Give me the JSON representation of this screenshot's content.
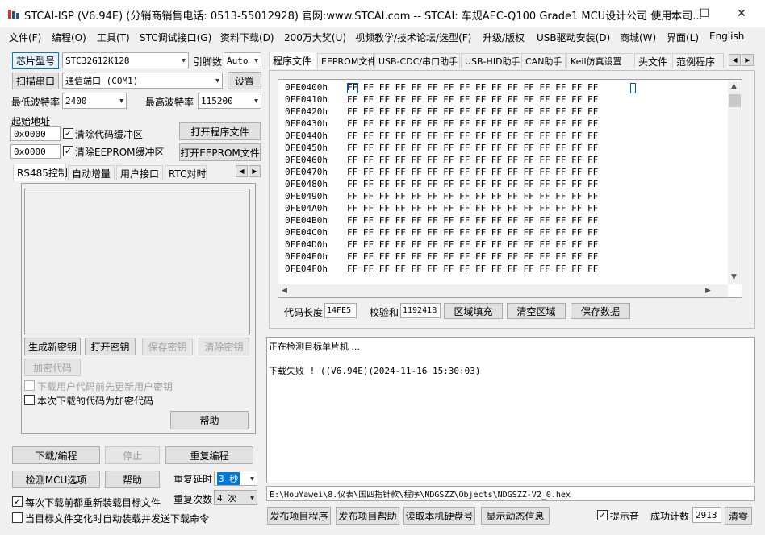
{
  "title": "STCAI-ISP (V6.94E) (分销商销售电话: 0513-55012928) 官网:www.STCAI.com  -- STCAI: 车规AEC-Q100 Grade1 MCU设计公司 使用本司...",
  "window_controls": {
    "minimize": "—",
    "maximize": "☐",
    "close": "✕"
  },
  "menu": [
    "文件(F)",
    "编程(O)",
    "工具(T)",
    "STC调试接口(G)",
    "资料下载(D)",
    "200万大奖(U)",
    "视频教学/技术论坛/选型(F)",
    "升级/版权",
    "USB驱动安装(D)",
    "商城(W)",
    "界面(L)",
    "English"
  ],
  "left": {
    "chip_button": "芯片型号",
    "chip_value": "STC32G12K128",
    "pin_label": "引脚数",
    "pin_value": "Auto",
    "scan_button": "扫描串口",
    "port_value": "通信端口 (COM1)",
    "settings_button": "设置",
    "min_baud_label": "最低波特率",
    "min_baud_value": "2400",
    "max_baud_label": "最高波特率",
    "max_baud_value": "115200",
    "start_addr_label": "起始地址",
    "addr1": "0x0000",
    "clear_code_label": "清除代码缓冲区",
    "open_prog_button": "打开程序文件",
    "addr2": "0x0000",
    "clear_eeprom_label": "清除EEPROM缓冲区",
    "open_eeprom_button": "打开EEPROM文件",
    "tabs": [
      "RS485控制",
      "自动增量",
      "用户接口",
      "RTC对时"
    ],
    "gen_key": "生成新密钥",
    "open_key": "打开密钥",
    "save_key": "保存密钥",
    "clear_key": "清除密钥",
    "encrypt_code": "加密代码",
    "chk_update_key": "下载用户代码前先更新用户密钥",
    "chk_encrypt": "本次下载的代码为加密代码",
    "help": "帮助",
    "download": "下载/编程",
    "stop": "停止",
    "reprogram": "重复编程",
    "check_mcu": "检测MCU选项",
    "help2": "帮助",
    "repeat_delay_label": "重复延时",
    "repeat_delay_value": "3 秒",
    "repeat_count_label": "重复次数",
    "repeat_count_value": "4 次",
    "chk_reload": "每次下载前都重新装载目标文件",
    "chk_auto": "当目标文件变化时自动装载并发送下载命令"
  },
  "right": {
    "tabs": [
      "程序文件",
      "EEPROM文件",
      "USB-CDC/串口助手",
      "USB-HID助手",
      "CAN助手",
      "Keil仿真设置",
      "头文件",
      "范例程序"
    ],
    "hex_rows": [
      {
        "addr": "0FE0400h",
        "bytes": "FF FF FF FF FF FF FF FF FF FF FF FF FF FF FF FF"
      },
      {
        "addr": "0FE0410h",
        "bytes": "FF FF FF FF FF FF FF FF FF FF FF FF FF FF FF FF"
      },
      {
        "addr": "0FE0420h",
        "bytes": "FF FF FF FF FF FF FF FF FF FF FF FF FF FF FF FF"
      },
      {
        "addr": "0FE0430h",
        "bytes": "FF FF FF FF FF FF FF FF FF FF FF FF FF FF FF FF"
      },
      {
        "addr": "0FE0440h",
        "bytes": "FF FF FF FF FF FF FF FF FF FF FF FF FF FF FF FF"
      },
      {
        "addr": "0FE0450h",
        "bytes": "FF FF FF FF FF FF FF FF FF FF FF FF FF FF FF FF"
      },
      {
        "addr": "0FE0460h",
        "bytes": "FF FF FF FF FF FF FF FF FF FF FF FF FF FF FF FF"
      },
      {
        "addr": "0FE0470h",
        "bytes": "FF FF FF FF FF FF FF FF FF FF FF FF FF FF FF FF"
      },
      {
        "addr": "0FE0480h",
        "bytes": "FF FF FF FF FF FF FF FF FF FF FF FF FF FF FF FF"
      },
      {
        "addr": "0FE0490h",
        "bytes": "FF FF FF FF FF FF FF FF FF FF FF FF FF FF FF FF"
      },
      {
        "addr": "0FE04A0h",
        "bytes": "FF FF FF FF FF FF FF FF FF FF FF FF FF FF FF FF"
      },
      {
        "addr": "0FE04B0h",
        "bytes": "FF FF FF FF FF FF FF FF FF FF FF FF FF FF FF FF"
      },
      {
        "addr": "0FE04C0h",
        "bytes": "FF FF FF FF FF FF FF FF FF FF FF FF FF FF FF FF"
      },
      {
        "addr": "0FE04D0h",
        "bytes": "FF FF FF FF FF FF FF FF FF FF FF FF FF FF FF FF"
      },
      {
        "addr": "0FE04E0h",
        "bytes": "FF FF FF FF FF FF FF FF FF FF FF FF FF FF FF FF"
      },
      {
        "addr": "0FE04F0h",
        "bytes": "FF FF FF FF FF FF FF FF FF FF FF FF FF FF FF FF"
      }
    ],
    "code_len_label": "代码长度",
    "code_len_value": "14FE5",
    "checksum_label": "校验和",
    "checksum_value": "119241B",
    "fill_button": "区域填充",
    "clear_button": "清空区域",
    "save_button": "保存数据",
    "log_lines": [
      "正在检测目标单片机 ...",
      "",
      "下载失败 ! ((V6.94E)(2024-11-16 15:30:03)"
    ],
    "file_path": "E:\\HouYawei\\8.仪表\\国四指针款\\程序\\NDGSZZ\\Objects\\NDGSZZ-V2_0.hex",
    "publish_prog": "发布项目程序",
    "publish_help": "发布项目帮助",
    "read_disk": "读取本机硬盘号",
    "show_dynamic": "显示动态信息",
    "chk_sound": "提示音",
    "success_label": "成功计数",
    "success_value": "2913",
    "reset_button": "清零"
  }
}
